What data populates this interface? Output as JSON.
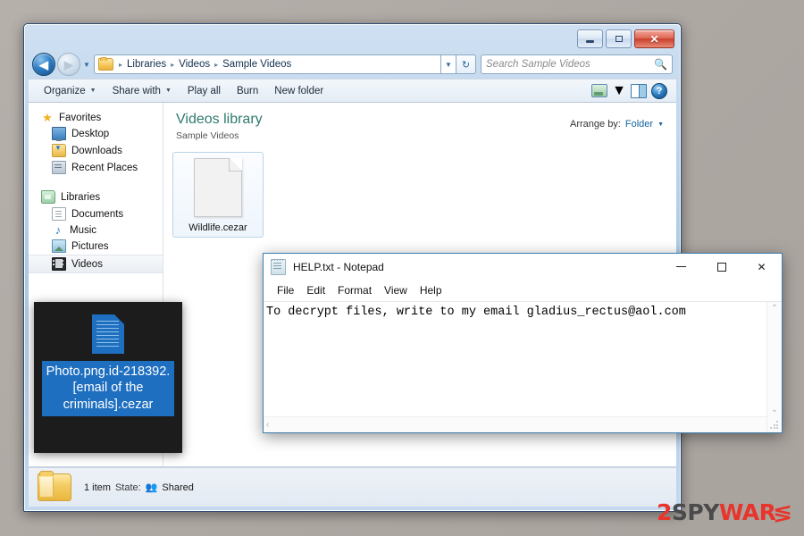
{
  "explorer": {
    "window_buttons": {
      "minimize": "minimize-button",
      "maximize": "maximize-button",
      "close": "✕"
    },
    "nav": {
      "back": "◀",
      "forward": "▶",
      "history_caret": "▼"
    },
    "breadcrumb": {
      "separator": "▸",
      "items": [
        "Libraries",
        "Videos",
        "Sample Videos"
      ]
    },
    "address_dropdown": "▼",
    "refresh": "↻",
    "search": {
      "placeholder": "Search Sample Videos",
      "icon": "search-icon"
    },
    "toolbar": {
      "organize": "Organize",
      "share_with": "Share with",
      "play_all": "Play all",
      "burn": "Burn",
      "new_folder": "New folder",
      "caret": "▼",
      "view_icon": "view-mode-icon",
      "preview_icon": "preview-pane-icon",
      "help_icon": "?"
    },
    "sidebar": {
      "groups": [
        {
          "header": {
            "label": "Favorites",
            "icon": "star-icon"
          },
          "items": [
            {
              "label": "Desktop",
              "icon": "desktop-icon"
            },
            {
              "label": "Downloads",
              "icon": "downloads-icon"
            },
            {
              "label": "Recent Places",
              "icon": "recent-places-icon"
            }
          ]
        },
        {
          "header": {
            "label": "Libraries",
            "icon": "libraries-icon"
          },
          "items": [
            {
              "label": "Documents",
              "icon": "documents-icon"
            },
            {
              "label": "Music",
              "icon": "music-icon"
            },
            {
              "label": "Pictures",
              "icon": "pictures-icon"
            },
            {
              "label": "Videos",
              "icon": "videos-icon",
              "selected": true
            }
          ]
        }
      ]
    },
    "content": {
      "library_title": "Videos library",
      "library_subtitle": "Sample Videos",
      "arrange_label": "Arrange by:",
      "arrange_value": "Folder",
      "arrange_caret": "▼",
      "files": [
        {
          "name": "Wildlife.cezar",
          "icon": "generic-file-icon"
        }
      ]
    },
    "details": {
      "item_count": "1 item",
      "state_label": "State:",
      "state_icon": "shared-users-icon",
      "state_value": "Shared",
      "folder_icon": "folder-icon"
    }
  },
  "overlay": {
    "file_icon": "encrypted-file-icon",
    "file_name": "Photo.png.id-218392.[email of the criminals].cezar",
    "highlight_color": "#1f6fc0",
    "background_color": "#1c1c1c"
  },
  "notepad": {
    "icon": "notepad-icon",
    "title": "HELP.txt - Notepad",
    "controls": {
      "minimize": "minimize-button",
      "maximize": "maximize-button",
      "close": "✕"
    },
    "menu": [
      "File",
      "Edit",
      "Format",
      "View",
      "Help"
    ],
    "body_text": "To decrypt files, write to my email gladius_rectus@aol.com",
    "scroll": {
      "up": "⌃",
      "down": "⌄",
      "left": "‹",
      "right": "›"
    }
  },
  "watermark": {
    "part1": "2",
    "part2": "SPY",
    "part3": "WAR",
    "bolt": "≶",
    "color_red": "#e8342a",
    "color_dark": "#4a4a4a"
  }
}
